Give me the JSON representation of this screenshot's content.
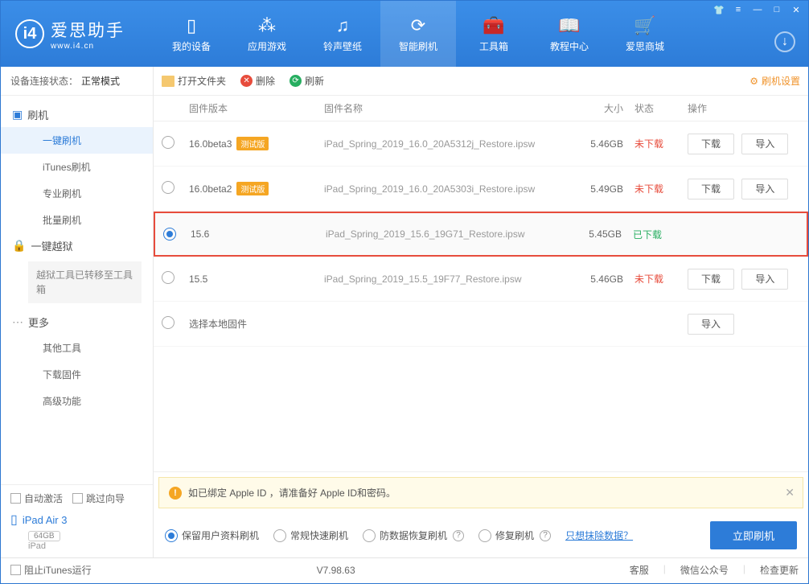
{
  "app": {
    "title": "爱思助手",
    "subtitle": "www.i4.cn"
  },
  "nav": [
    {
      "label": "我的设备"
    },
    {
      "label": "应用游戏"
    },
    {
      "label": "铃声壁纸"
    },
    {
      "label": "智能刷机"
    },
    {
      "label": "工具箱"
    },
    {
      "label": "教程中心"
    },
    {
      "label": "爱思商城"
    }
  ],
  "sidebar": {
    "conn_label": "设备连接状态：",
    "conn_mode": "正常模式",
    "flash_heading": "刷机",
    "items_flash": [
      "一键刷机",
      "iTunes刷机",
      "专业刷机",
      "批量刷机"
    ],
    "jailbreak_heading": "一键越狱",
    "jb_notice": "越狱工具已转移至工具箱",
    "more_heading": "更多",
    "items_more": [
      "其他工具",
      "下载固件",
      "高级功能"
    ],
    "auto_activate": "自动激活",
    "skip_wizard": "跳过向导",
    "device_name": "iPad Air 3",
    "device_storage": "64GB",
    "device_type": "iPad"
  },
  "toolbar": {
    "open_folder": "打开文件夹",
    "delete": "删除",
    "refresh": "刷新",
    "settings": "刷机设置"
  },
  "table": {
    "headers": {
      "version": "固件版本",
      "name": "固件名称",
      "size": "大小",
      "status": "状态",
      "action": "操作"
    },
    "rows": [
      {
        "version": "16.0beta3",
        "badge": "测试版",
        "name": "iPad_Spring_2019_16.0_20A5312j_Restore.ipsw",
        "size": "5.46GB",
        "status": "未下载",
        "status_class": "notdl",
        "sel": false,
        "hi": false,
        "dl": "下载",
        "im": "导入"
      },
      {
        "version": "16.0beta2",
        "badge": "测试版",
        "name": "iPad_Spring_2019_16.0_20A5303i_Restore.ipsw",
        "size": "5.49GB",
        "status": "未下载",
        "status_class": "notdl",
        "sel": false,
        "hi": false,
        "dl": "下载",
        "im": "导入"
      },
      {
        "version": "15.6",
        "badge": "",
        "name": "iPad_Spring_2019_15.6_19G71_Restore.ipsw",
        "size": "5.45GB",
        "status": "已下载",
        "status_class": "dl",
        "sel": true,
        "hi": true,
        "dl": "",
        "im": ""
      },
      {
        "version": "15.5",
        "badge": "",
        "name": "iPad_Spring_2019_15.5_19F77_Restore.ipsw",
        "size": "5.46GB",
        "status": "未下载",
        "status_class": "notdl",
        "sel": false,
        "hi": false,
        "dl": "下载",
        "im": "导入"
      },
      {
        "version": "选择本地固件",
        "badge": "",
        "name": "",
        "size": "",
        "status": "",
        "status_class": "",
        "sel": false,
        "hi": false,
        "dl": "",
        "im": "导入"
      }
    ]
  },
  "alert": {
    "text": "如已绑定 Apple ID ，请准备好 Apple ID和密码。"
  },
  "flash_opts": {
    "keep_data": "保留用户资料刷机",
    "quick": "常规快速刷机",
    "recover": "防数据恢复刷机",
    "repair": "修复刷机",
    "erase_link": "只想抹除数据？",
    "button": "立即刷机"
  },
  "footer": {
    "block_itunes": "阻止iTunes运行",
    "version": "V7.98.63",
    "support": "客服",
    "wechat": "微信公众号",
    "update": "检查更新"
  }
}
